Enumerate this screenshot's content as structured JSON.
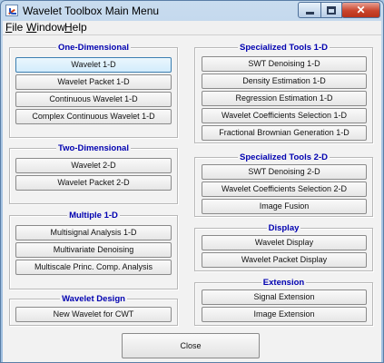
{
  "window": {
    "title": "Wavelet Toolbox Main Menu"
  },
  "menubar": {
    "file": "ile",
    "file_mnemonic": "F",
    "window": "indow",
    "window_mnemonic": "W",
    "help": "elp",
    "help_mnemonic": "H"
  },
  "one_d": {
    "title": "One-Dimensional",
    "buttons": [
      "Wavelet 1-D",
      "Wavelet Packet 1-D",
      "Continuous Wavelet 1-D",
      "Complex Continuous Wavelet 1-D"
    ]
  },
  "two_d": {
    "title": "Two-Dimensional",
    "buttons": [
      "Wavelet 2-D",
      "Wavelet Packet 2-D"
    ]
  },
  "multiple": {
    "title": "Multiple 1-D",
    "buttons": [
      "Multisignal Analysis 1-D",
      "Multivariate Denoising",
      "Multiscale Princ. Comp. Analysis"
    ]
  },
  "design": {
    "title": "Wavelet Design",
    "buttons": [
      "New Wavelet for CWT"
    ]
  },
  "spec1": {
    "title": "Specialized Tools 1-D",
    "buttons": [
      "SWT Denoising 1-D",
      "Density Estimation 1-D",
      "Regression Estimation 1-D",
      "Wavelet Coefficients Selection 1-D",
      "Fractional Brownian Generation 1-D"
    ]
  },
  "spec2": {
    "title": "Specialized Tools 2-D",
    "buttons": [
      "SWT Denoising 2-D",
      "Wavelet Coefficients Selection 2-D",
      "Image Fusion"
    ]
  },
  "display": {
    "title": "Display",
    "buttons": [
      "Wavelet Display",
      "Wavelet Packet Display"
    ]
  },
  "extension": {
    "title": "Extension",
    "buttons": [
      "Signal Extension",
      "Image Extension"
    ]
  },
  "footer": {
    "close": "Close"
  },
  "colors": {
    "frame_title": "#0000b0",
    "titlebar": "#a7c4e2",
    "close_button": "#c9442c"
  }
}
